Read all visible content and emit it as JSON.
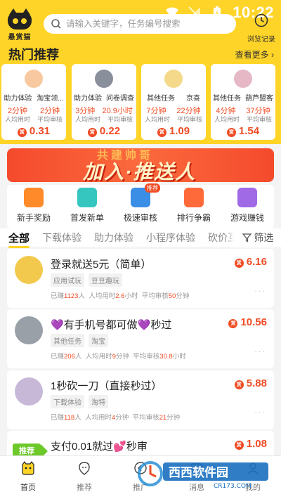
{
  "status_bar": {
    "time": "10:22"
  },
  "header": {
    "logo_text": "悬赏猫",
    "search_placeholder": "请输入关键字，任务编号搜索",
    "history_label": "浏览记录"
  },
  "hot": {
    "title": "热门推荐",
    "more_label": "查看更多 ›",
    "avg_time_label": "人均用时",
    "avg_review_label": "平均审核",
    "cards": [
      {
        "cat1": "助力体验",
        "cat2": "淘宝领...",
        "time": "2分钟",
        "review": "2分钟",
        "price": "0.31",
        "avatar_color": "#f8c9a0"
      },
      {
        "cat1": "助力体验",
        "cat2": "问卷调查",
        "time": "3分钟",
        "review": "20.9小时",
        "price": "0.22",
        "avatar_color": "#8a8f9c"
      },
      {
        "cat1": "其他任务",
        "cat2": "京喜",
        "time": "7分钟",
        "review": "22分钟",
        "price": "1.09",
        "avatar_color": "#f5d98a"
      },
      {
        "cat1": "其他任务",
        "cat2": "葫芦盟客",
        "time": "4分钟",
        "review": "37分钟",
        "price": "1.54",
        "avatar_color": "#e6b8c6"
      }
    ]
  },
  "banner": {
    "ghost_text": "共建帅哥",
    "main_text": "加入·推送人"
  },
  "shortcuts": [
    {
      "label": "新手奖励",
      "color": "#ff8a2a"
    },
    {
      "label": "首发新单",
      "color": "#36c6c0"
    },
    {
      "label": "极速审核",
      "color": "#3a8ee6",
      "badge": "推荐"
    },
    {
      "label": "排行争霸",
      "color": "#ff6a3a"
    },
    {
      "label": "游戏赚钱",
      "color": "#a06ae6"
    }
  ],
  "tabs": [
    "全部",
    "下载体验",
    "助力体验",
    "小程序体验",
    "砍价互帮"
  ],
  "filter_label": "筛选",
  "tasks": [
    {
      "title": "登录就送5元（简单）",
      "tags": [
        "应用试玩",
        "豆豆趣玩"
      ],
      "earned_prefix": "已赚",
      "earned": "1123",
      "earned_unit": "人",
      "time_label": "人均用时",
      "time": "2.6",
      "time_unit": "小时",
      "review_label": "平均审核",
      "review": "50",
      "review_unit": "分钟",
      "price": "6.16",
      "avatar_color": "#f2c94c"
    },
    {
      "title": "💜有手机号都可做💜秒过",
      "tags": [
        "其他任务",
        "淘宝"
      ],
      "earned_prefix": "已赚",
      "earned": "206",
      "earned_unit": "人",
      "time_label": "人均用时",
      "time": "9",
      "time_unit": "分钟",
      "review_label": "平均审核",
      "review": "30.8",
      "review_unit": "小时",
      "price": "10.56",
      "avatar_color": "#9aa0a8"
    },
    {
      "title": "1秒砍一刀（直接秒过）",
      "tags": [
        "下载体验",
        "淘特"
      ],
      "earned_prefix": "已赚",
      "earned": "118",
      "earned_unit": "人",
      "time_label": "人均用时",
      "time": "4",
      "time_unit": "分钟",
      "review_label": "平均审核",
      "review": "21",
      "review_unit": "分钟",
      "price": "5.88",
      "avatar_color": "#c7b8d8"
    },
    {
      "title": "支付0.01就过💕秒审",
      "tags": [],
      "price": "1.08",
      "recommend": "推荐"
    }
  ],
  "bottom_nav": [
    {
      "label": "首页",
      "active": true
    },
    {
      "label": "推荐",
      "active": false
    },
    {
      "label": "推广",
      "active": false
    },
    {
      "label": "消息",
      "active": false
    },
    {
      "label": "我的",
      "active": false
    }
  ],
  "watermark": {
    "text": "西西软件园",
    "sub": "CR173.COM"
  },
  "colors": {
    "brand_yellow": "#ffd428",
    "price_red": "#f04c24"
  }
}
